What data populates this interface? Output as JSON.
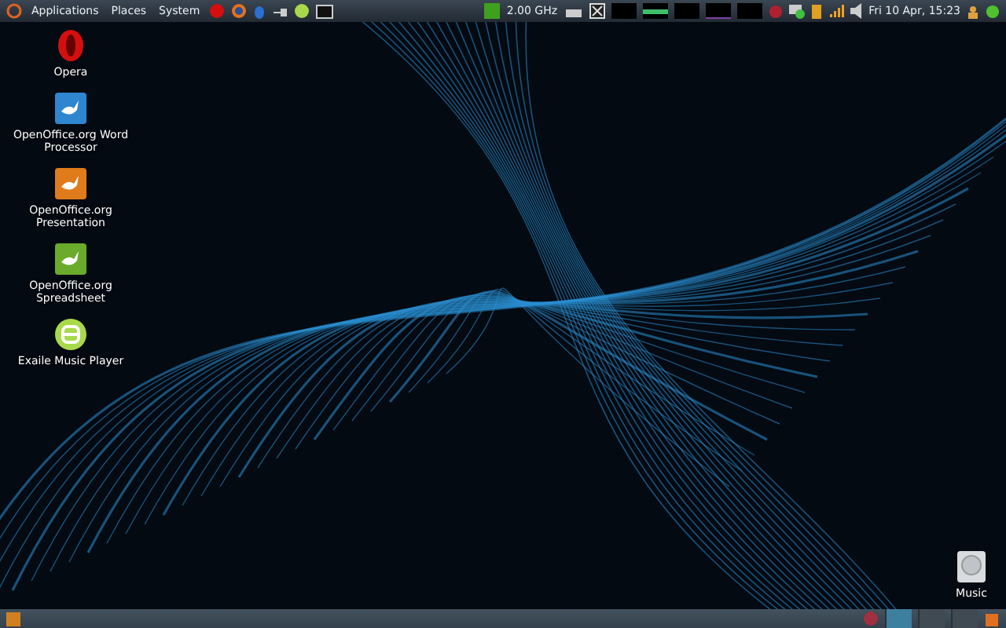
{
  "top_panel": {
    "menus": [
      "Applications",
      "Places",
      "System"
    ],
    "cpu_frequency": "2.00 GHz",
    "clock": "Fri 10 Apr, 15:23"
  },
  "desktop_icons": [
    {
      "kind": "opera",
      "label": "Opera"
    },
    {
      "kind": "writer",
      "label": "OpenOffice.org Word Processor"
    },
    {
      "kind": "impress",
      "label": "OpenOffice.org Presentation"
    },
    {
      "kind": "calc",
      "label": "OpenOffice.org Spreadsheet"
    },
    {
      "kind": "exaile",
      "label": "Exaile Music Player"
    }
  ],
  "drive_icon": {
    "label": "Music"
  },
  "bottom_panel": {
    "workspaces": [
      {
        "selected": true
      },
      {
        "selected": false
      },
      {
        "selected": false
      }
    ]
  }
}
